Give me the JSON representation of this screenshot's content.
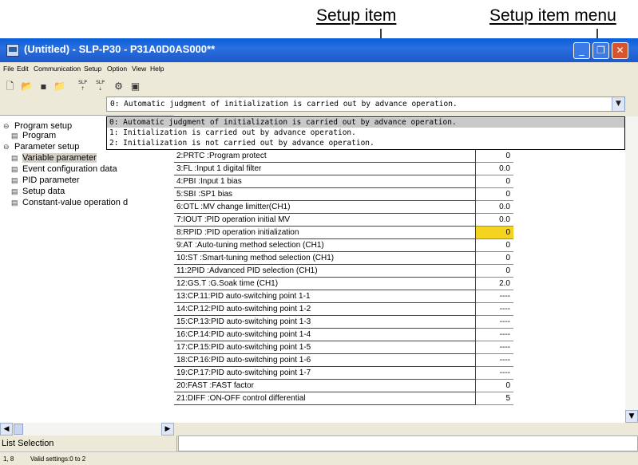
{
  "annotations": {
    "setup_item": "Setup item",
    "setup_item_menu": "Setup item menu"
  },
  "window": {
    "title": "(Untitled) - SLP-P30 - P31A0D0AS000**"
  },
  "menu": [
    "File",
    "Edit",
    "Communication",
    "Setup",
    "Option",
    "View",
    "Help"
  ],
  "toolbar": {
    "slp_label": "SLP"
  },
  "combo": {
    "value": "0: Automatic judgment of initialization is carried out by advance operation."
  },
  "dropdown": {
    "options": [
      "0: Automatic judgment of initialization is carried out by advance operation.",
      "1: Initialization is carried out by advance operation.",
      "2: Initialization is not carried out by advance operation."
    ]
  },
  "tree": {
    "program_setup": "Program setup",
    "program": "Program",
    "parameter_setup": "Parameter setup",
    "variable_parameter": "Variable parameter",
    "event_configuration_data": "Event configuration data",
    "pid_parameter": "PID parameter",
    "setup_data": "Setup data",
    "constant_value_operation": "Constant-value operation d"
  },
  "grid": {
    "rows": [
      {
        "name": "2:PRTC :Program protect",
        "value": "0"
      },
      {
        "name": "3:FL   :Input 1 digital filter",
        "value": "0.0"
      },
      {
        "name": "4:PBI  :Input 1 bias",
        "value": "0"
      },
      {
        "name": "5:SBI  :SP1 bias",
        "value": "0"
      },
      {
        "name": "6:OTL  :MV change limitter(CH1)",
        "value": "0.0"
      },
      {
        "name": "7:IOUT :PID operation initial MV",
        "value": "0.0"
      },
      {
        "name": "8:RPID :PID operation initialization",
        "value": "0"
      },
      {
        "name": "9:AT   :Auto-tuning method selection (CH1)",
        "value": "0"
      },
      {
        "name": "10:ST   :Smart-tuning method selection (CH1)",
        "value": "0"
      },
      {
        "name": "11:2PID :Advanced PID selection (CH1)",
        "value": "0"
      },
      {
        "name": "12:GS.T :G.Soak time (CH1)",
        "value": "2.0"
      },
      {
        "name": "13:CP.11:PID auto-switching point 1-1",
        "value": "----"
      },
      {
        "name": "14:CP.12:PID auto-switching point 1-2",
        "value": "----"
      },
      {
        "name": "15:CP.13:PID auto-switching point 1-3",
        "value": "----"
      },
      {
        "name": "16:CP.14:PID auto-switching point 1-4",
        "value": "----"
      },
      {
        "name": "17:CP.15:PID auto-switching point 1-5",
        "value": "----"
      },
      {
        "name": "18:CP.16:PID auto-switching point 1-6",
        "value": "----"
      },
      {
        "name": "19:CP.17:PID auto-switching point 1-7",
        "value": "----"
      },
      {
        "name": "20:FAST :FAST factor",
        "value": "0"
      },
      {
        "name": "21:DIFF :ON-OFF control differential",
        "value": "5"
      }
    ]
  },
  "bottom": {
    "list_selection": "List Selection"
  },
  "status": {
    "position": "1, 8",
    "message": "Valid settings:0 to 2"
  },
  "colors": {
    "highlight": "#f5d421",
    "titlebar": "#0a5fd8"
  }
}
